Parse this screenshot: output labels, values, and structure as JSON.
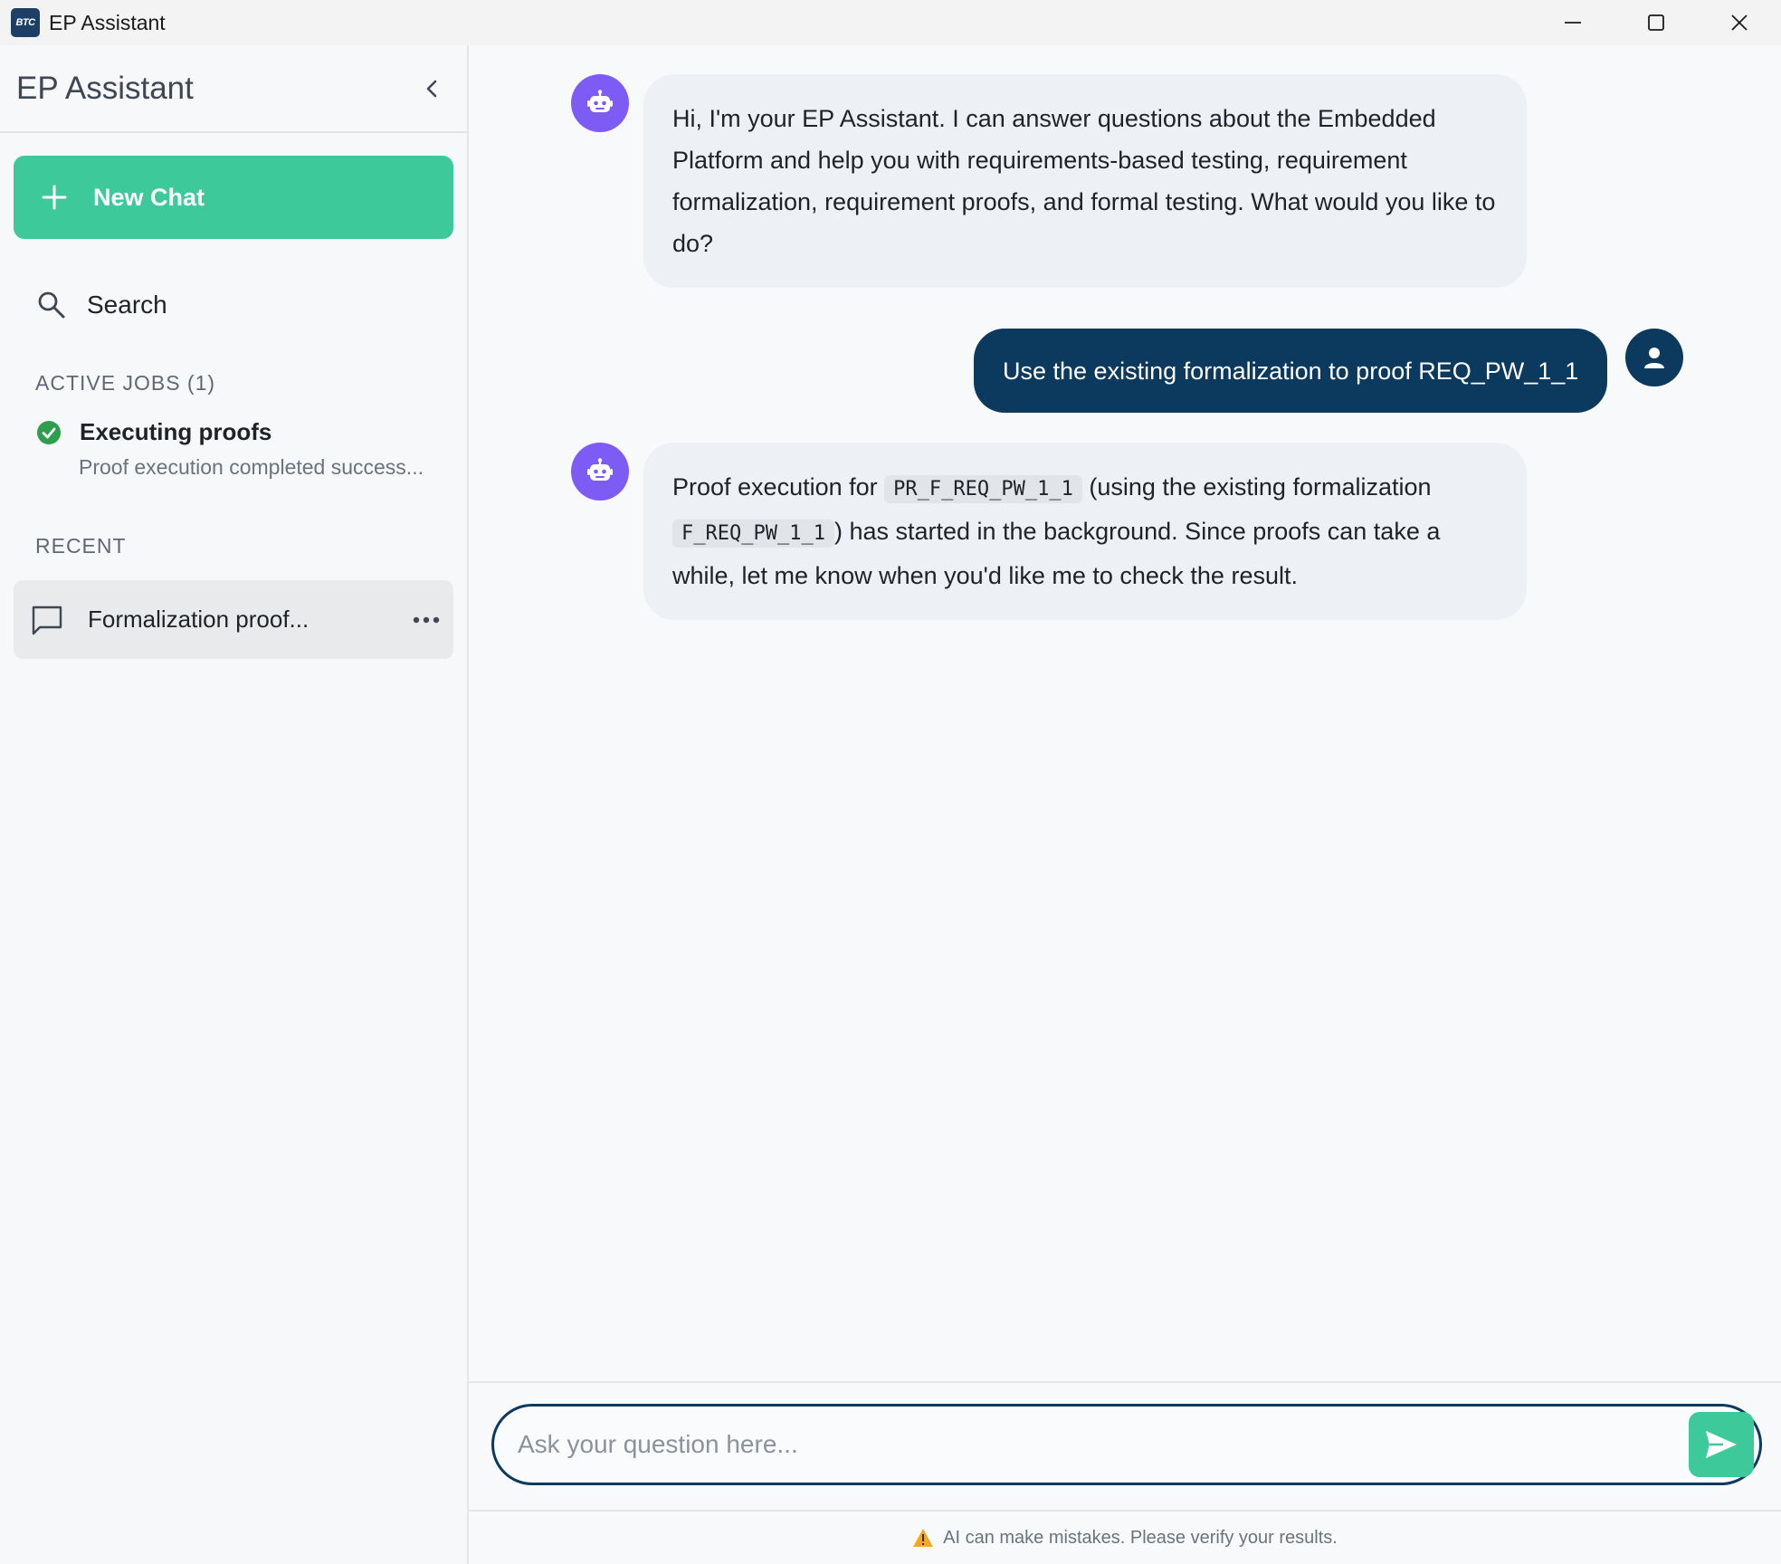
{
  "window": {
    "logo_text": "BTC",
    "title": "EP Assistant"
  },
  "sidebar": {
    "title": "EP Assistant",
    "new_chat_label": "New Chat",
    "search_label": "Search",
    "active_jobs_label": "ACTIVE JOBS (1)",
    "active_jobs": [
      {
        "title": "Executing proofs",
        "status": "Proof execution completed success..."
      }
    ],
    "recent_label": "RECENT",
    "recent_items": [
      {
        "label": "Formalization proof..."
      }
    ]
  },
  "chat": {
    "messages": [
      {
        "role": "assistant",
        "text": "Hi, I'm your EP Assistant. I can answer questions about the Embedded Platform and help you with requirements-based testing, requirement formalization, requirement proofs, and formal testing. What would you like to do?"
      },
      {
        "role": "user",
        "text": "Use the existing formalization to proof REQ_PW_1_1"
      },
      {
        "role": "assistant",
        "parts": {
          "p1": "Proof execution for ",
          "code1": "PR_F_REQ_PW_1_1",
          "p2": " (using the existing formalization ",
          "code2": "F_REQ_PW_1_1",
          "p3": ") has started in the background. Since proofs can take a while, let me know when you'd like me to check the result."
        }
      }
    ]
  },
  "composer": {
    "placeholder": "Ask your question here..."
  },
  "footer": {
    "disclaimer": "AI can make mistakes. Please verify your results."
  },
  "colors": {
    "accent_green": "#3ec99b",
    "navy": "#0c3a5e",
    "bot_purple": "#7c5cf5",
    "success_green": "#2e9e4f"
  },
  "icons": {
    "window": [
      "minimize-icon",
      "maximize-icon",
      "close-icon"
    ],
    "sidebar": [
      "chevron-left-icon",
      "plus-icon",
      "search-icon",
      "check-circle-icon",
      "chat-bubble-icon",
      "more-horizontal-icon"
    ],
    "chat": [
      "robot-icon",
      "user-icon",
      "send-icon",
      "warning-icon"
    ]
  }
}
